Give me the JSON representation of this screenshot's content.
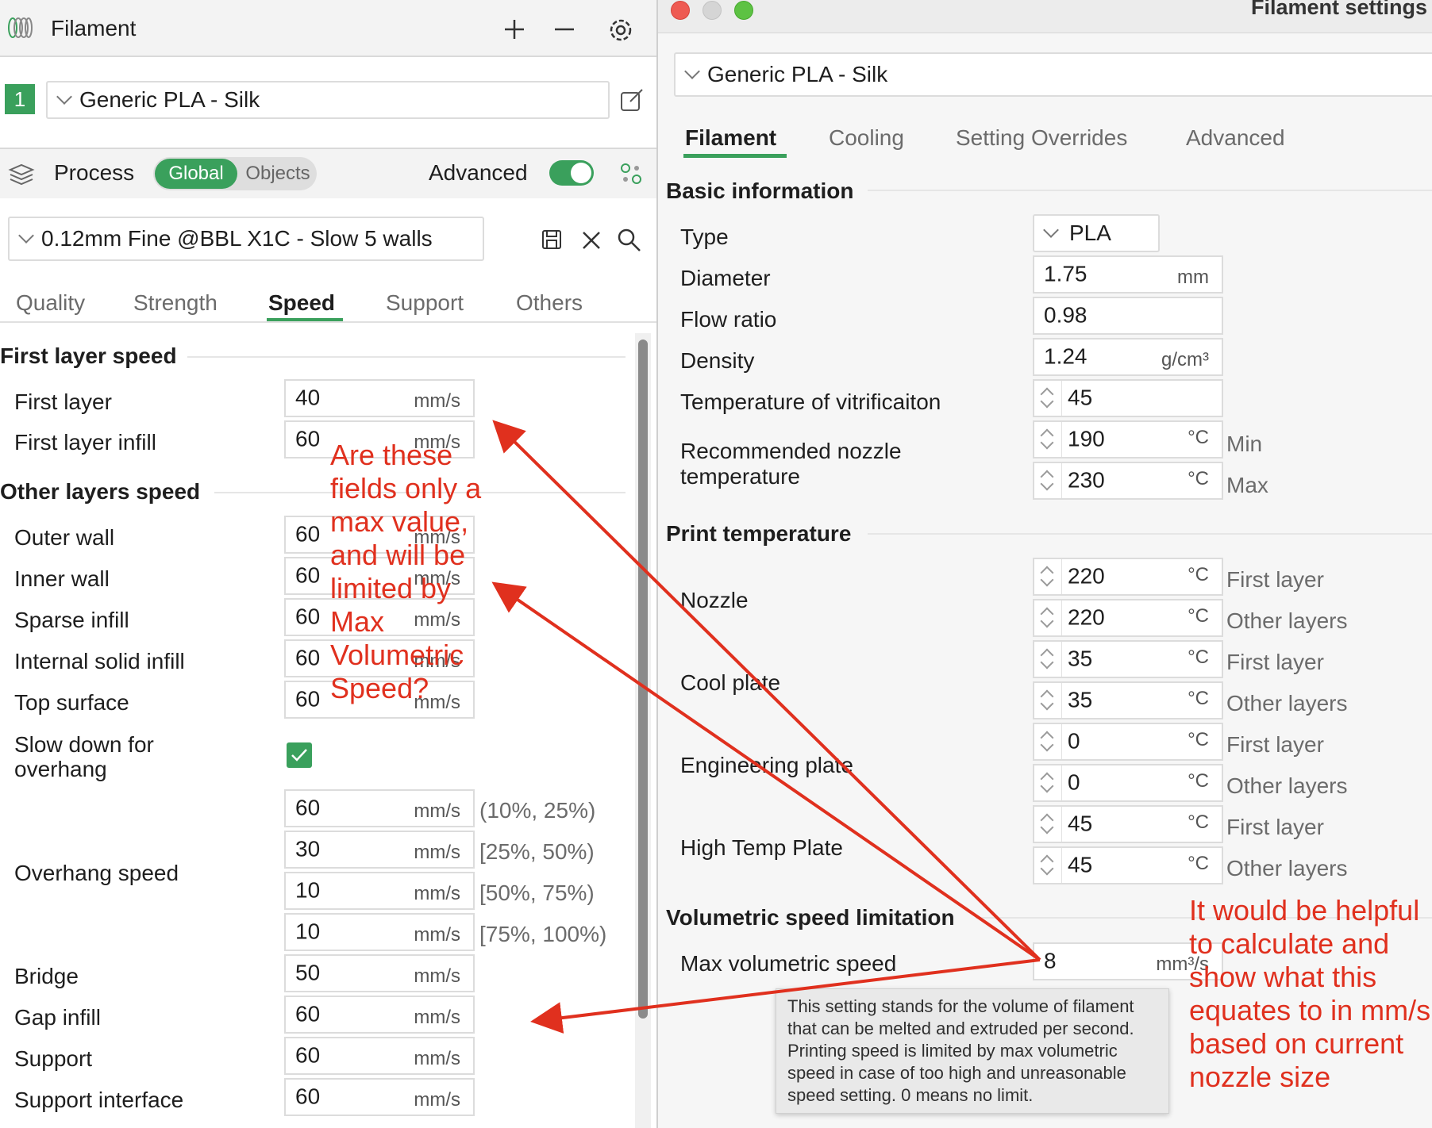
{
  "colors": {
    "accent": "#3aa05c",
    "annotation": "#e0301e"
  },
  "left": {
    "filament_header": {
      "title": "Filament",
      "icons": [
        "filament-spool-icon",
        "plus-icon",
        "minus-icon",
        "gear-icon"
      ]
    },
    "filament_slot": {
      "index": "1",
      "profile": "Generic PLA - Silk"
    },
    "process_header": {
      "title": "Process",
      "toggle_global": "Global",
      "toggle_objects": "Objects",
      "advanced_label": "Advanced",
      "advanced_on": true
    },
    "process_profile": "0.12mm Fine @BBL X1C - Slow 5 walls",
    "tabs": [
      "Quality",
      "Strength",
      "Speed",
      "Support",
      "Others"
    ],
    "active_tab": "Speed",
    "sections": {
      "first_layer_speed": "First layer speed",
      "other_layers_speed": "Other layers speed"
    },
    "first_layer_rows": [
      {
        "label": "First layer",
        "value": "40",
        "unit": "mm/s"
      },
      {
        "label": "First layer infill",
        "value": "60",
        "unit": "mm/s"
      }
    ],
    "other_rows": [
      {
        "label": "Outer wall",
        "value": "60",
        "unit": "mm/s"
      },
      {
        "label": "Inner wall",
        "value": "60",
        "unit": "mm/s"
      },
      {
        "label": "Sparse infill",
        "value": "60",
        "unit": "mm/s"
      },
      {
        "label": "Internal solid infill",
        "value": "60",
        "unit": "mm/s"
      },
      {
        "label": "Top surface",
        "value": "60",
        "unit": "mm/s"
      }
    ],
    "slowdown": {
      "label_line1": "Slow down for",
      "label_line2": "overhang",
      "checked": true
    },
    "overhang": {
      "label": "Overhang speed",
      "rows": [
        {
          "value": "60",
          "unit": "mm/s",
          "range": "(10%, 25%)"
        },
        {
          "value": "30",
          "unit": "mm/s",
          "range": "[25%, 50%)"
        },
        {
          "value": "10",
          "unit": "mm/s",
          "range": "[50%, 75%)"
        },
        {
          "value": "10",
          "unit": "mm/s",
          "range": "[75%, 100%)"
        }
      ]
    },
    "tail_rows": [
      {
        "label": "Bridge",
        "value": "50",
        "unit": "mm/s"
      },
      {
        "label": "Gap infill",
        "value": "60",
        "unit": "mm/s"
      },
      {
        "label": "Support",
        "value": "60",
        "unit": "mm/s"
      },
      {
        "label": "Support interface",
        "value": "60",
        "unit": "mm/s"
      }
    ]
  },
  "right": {
    "window_title": "Filament settings",
    "profile": "Generic PLA - Silk",
    "tabs": [
      "Filament",
      "Cooling",
      "Setting Overrides",
      "Advanced"
    ],
    "active_tab": "Filament",
    "basic": {
      "title": "Basic information",
      "type_label": "Type",
      "type_value": "PLA",
      "diameter_label": "Diameter",
      "diameter_value": "1.75",
      "diameter_unit": "mm",
      "flow_label": "Flow ratio",
      "flow_value": "0.98",
      "density_label": "Density",
      "density_value": "1.24",
      "density_unit": "g/cm³",
      "vitri_label": "Temperature of vitrificaiton",
      "vitri_value": "45",
      "nozzle_label_line1": "Recommended nozzle",
      "nozzle_label_line2": "temperature",
      "nozzle_min": "190",
      "nozzle_max": "230",
      "temp_unit": "°C",
      "min_label": "Min",
      "max_label": "Max"
    },
    "print_temp": {
      "title": "Print temperature",
      "groups": [
        {
          "label": "Nozzle",
          "first": "220",
          "other": "220"
        },
        {
          "label": "Cool plate",
          "first": "35",
          "other": "35"
        },
        {
          "label": "Engineering plate",
          "first": "0",
          "other": "0"
        },
        {
          "label": "High Temp Plate",
          "first": "45",
          "other": "45"
        }
      ],
      "unit": "°C",
      "first_layer": "First layer",
      "other_layers": "Other layers"
    },
    "volumetric": {
      "title": "Volumetric speed limitation",
      "label": "Max volumetric speed",
      "value": "8",
      "unit": "mm³/s",
      "tooltip": "This setting stands for the volume of filament\nthat can be melted and extruded per second.\nPrinting speed is limited by max volumetric\nspeed in case of too high and unreasonable\nspeed setting. 0 means no limit."
    }
  },
  "annotations": {
    "question": "Are these\nfields only a\nmax value,\nand will be\nlimited by\nMax\nVolumetric\nSpeed?",
    "suggestion": "It would be helpful\nto calculate and\nshow what this\nequates to in mm/s\nbased on current\nnozzle size"
  }
}
